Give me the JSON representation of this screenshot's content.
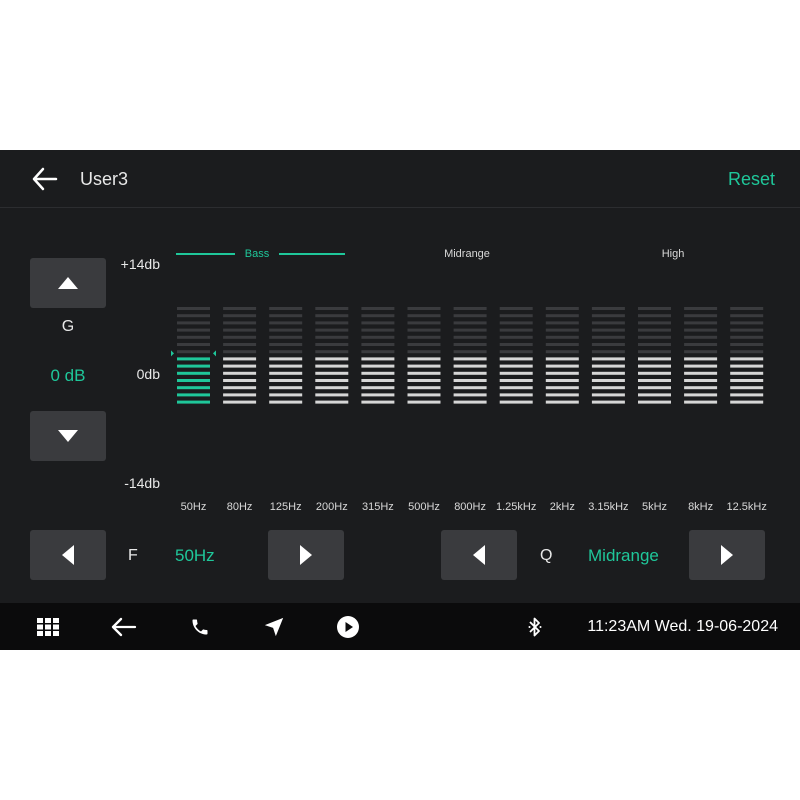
{
  "header": {
    "title": "User3",
    "reset_label": "Reset"
  },
  "gain": {
    "label": "G",
    "value": "0 dB",
    "db_max": "+14db",
    "db_mid": "0db",
    "db_min": "-14db"
  },
  "groups": {
    "bass": "Bass",
    "midrange": "Midrange",
    "high": "High"
  },
  "bands": [
    {
      "freq": "50Hz",
      "level": 7,
      "selected": true
    },
    {
      "freq": "80Hz",
      "level": 7,
      "selected": false
    },
    {
      "freq": "125Hz",
      "level": 7,
      "selected": false
    },
    {
      "freq": "200Hz",
      "level": 7,
      "selected": false
    },
    {
      "freq": "315Hz",
      "level": 7,
      "selected": false
    },
    {
      "freq": "500Hz",
      "level": 7,
      "selected": false
    },
    {
      "freq": "800Hz",
      "level": 7,
      "selected": false
    },
    {
      "freq": "1.25kHz",
      "level": 7,
      "selected": false
    },
    {
      "freq": "2kHz",
      "level": 7,
      "selected": false
    },
    {
      "freq": "3.15kHz",
      "level": 7,
      "selected": false
    },
    {
      "freq": "5kHz",
      "level": 7,
      "selected": false
    },
    {
      "freq": "8kHz",
      "level": 7,
      "selected": false
    },
    {
      "freq": "12.5kHz",
      "level": 7,
      "selected": false
    }
  ],
  "frequency": {
    "label": "F",
    "value": "50Hz"
  },
  "q_factor": {
    "label": "Q",
    "value": "Midrange"
  },
  "taskbar": {
    "icons": [
      "apps-grid-icon",
      "back-icon",
      "phone-icon",
      "navigation-icon",
      "play-icon",
      "bluetooth-icon"
    ],
    "clock": "11:23AM Wed. 19-06-2024"
  },
  "colors": {
    "accent": "#1fc79a",
    "background": "#1b1c1e",
    "button": "#3a3b3e",
    "taskbar": "#0b0b0c"
  }
}
